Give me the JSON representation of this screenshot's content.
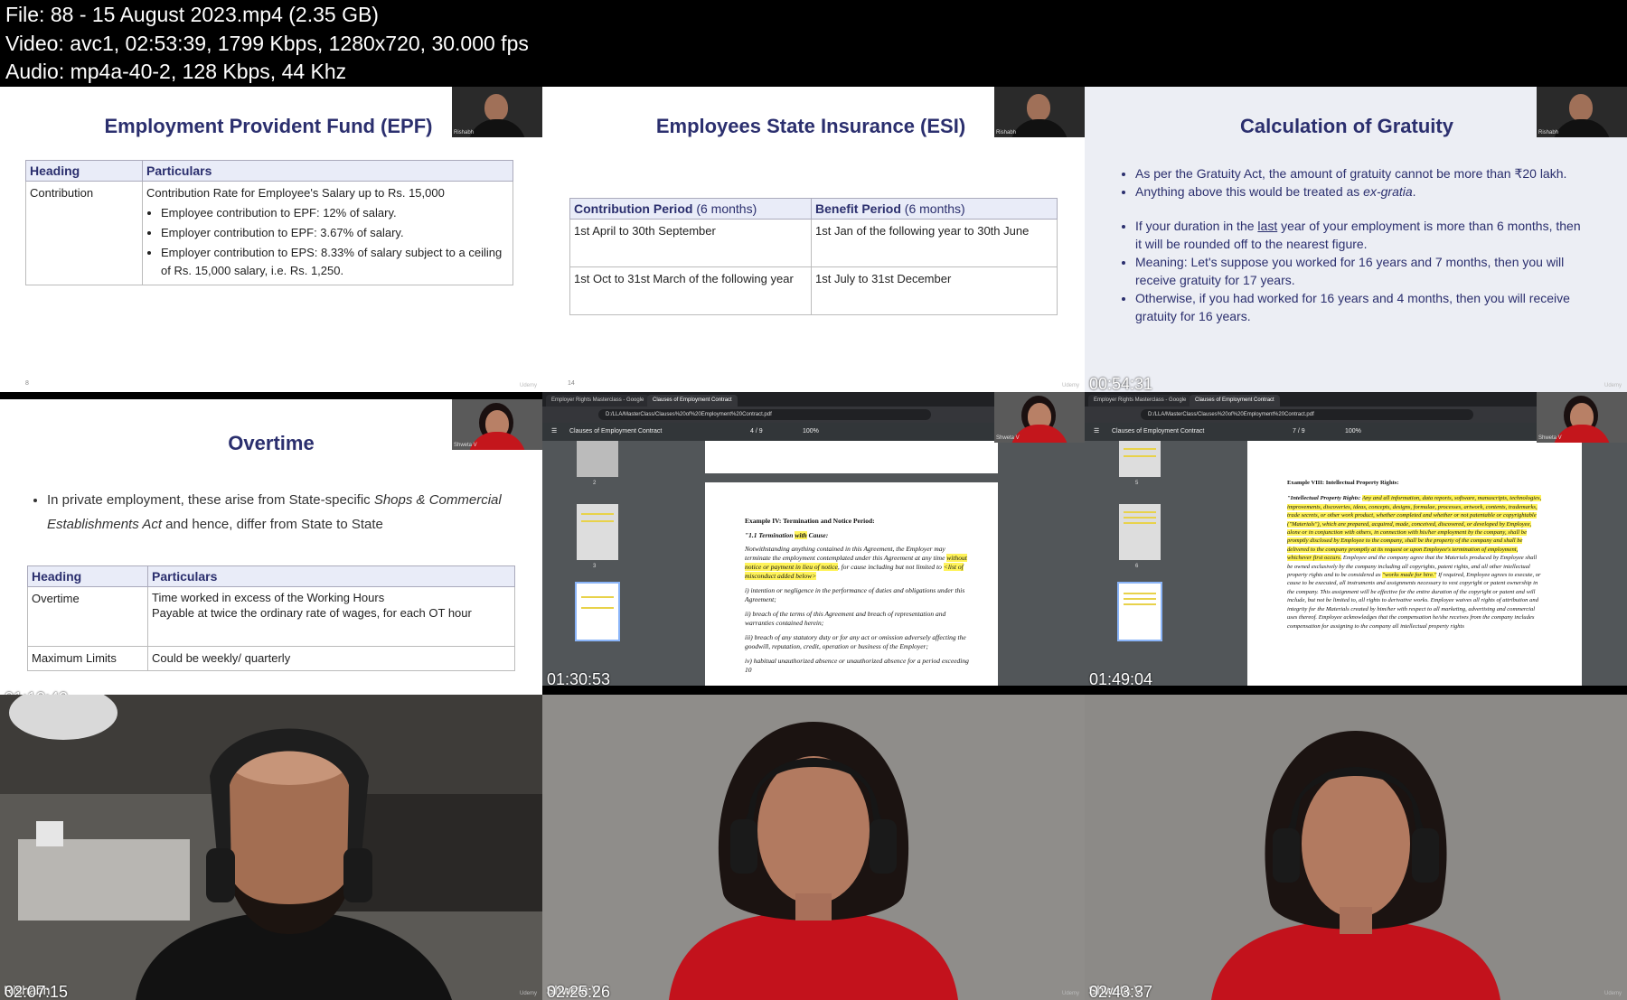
{
  "header": {
    "line1": "File: 88 - 15 August 2023.mp4 (2.35 GB)",
    "line2": "Video: avc1, 02:53:39, 1799 Kbps, 1280x720, 30.000 fps",
    "line3": "Audio: mp4a-40-2, 128 Kbps, 44 Khz"
  },
  "thumbs": [
    {
      "title": "Employment Provident Fund (EPF)",
      "col_heading": "Heading",
      "col_particulars": "Particulars",
      "row_heading": "Contribution",
      "row_intro": "Contribution Rate for Employee's Salary up to Rs. 15,000",
      "bullets": [
        "Employee contribution to EPF: 12% of salary.",
        "Employer contribution to EPF: 3.67% of salary.",
        "Employer contribution to EPS: 8.33% of salary subject to a ceiling of Rs. 15,000 salary, i.e. Rs. 1,250."
      ],
      "page": "8",
      "watermark": "Udemy",
      "cam_label": "Rishabh"
    },
    {
      "title": "Employees State Insurance (ESI)",
      "col1_bold": "Contribution Period",
      "col1_rest": " (6 months)",
      "col2_bold": "Benefit Period",
      "col2_rest": " (6 months)",
      "rows": [
        [
          "1st April to 30th September",
          "1st Jan of the following year to 30th June"
        ],
        [
          "1st Oct to 31st March of the following year",
          "1st July to 31st December"
        ]
      ],
      "page": "14",
      "watermark": "Udemy",
      "cam_label": "Rishabh"
    },
    {
      "title": "Calculation of Gratuity",
      "b1": "As per the Gratuity Act, the amount of gratuity cannot be more than ₹20 lakh.",
      "b2_pre": "Anything above this would be treated as ",
      "b2_em": "ex-gratia",
      "b2_post": ".",
      "b3_pre": "If your duration in the ",
      "b3_u": "last",
      "b3_post": " year of your employment is more than 6 months, then it will be rounded off to the nearest figure.",
      "b4": "Meaning: Let's suppose you worked for 16 years and 7 months, then you will receive gratuity for 17 years.",
      "b5": "Otherwise, if you had worked for 16 years and 4 months, then you will receive gratuity for 16 years.",
      "time": "00:54:31",
      "watermark": "Udemy",
      "cam_label": "Rishabh"
    },
    {
      "title": "Overtime",
      "intro_pre": "In private employment, these arise from State-specific ",
      "intro_em": "Shops & Commercial Establishments Act",
      "intro_post": " and hence, differ from State to State",
      "col_heading": "Heading",
      "col_particulars": "Particulars",
      "r1_head": "Overtime",
      "r1_line1": "Time worked in excess of the Working Hours",
      "r1_line2": "Payable at twice the ordinary rate of wages, for each OT hour",
      "r2_head": "Maximum Limits",
      "r2_val": "Could be weekly/ quarterly",
      "time": "01:12:42",
      "cam_label": "Shweta V"
    },
    {
      "tab1": "Employer Rights Masterclass - Google",
      "tab2": "Clauses of Employment Contract",
      "url": "D:/LLA/MasterClass/Clauses%20of%20Employment%20Contract.pdf",
      "doc_title": "Clauses of Employment Contract",
      "page_indicator": "4 / 9",
      "zoom": "100%",
      "thumb_labels": [
        "2",
        "3"
      ],
      "heading": "Example IV: Termination and Notice Period:",
      "sub_pre": "\"1.1 Termination ",
      "sub_hl": "with",
      "sub_post": " Cause:",
      "para1_pre": "Notwithstanding anything contained in this Agreement, the Employer may terminate the employment contemplated under this Agreement at any time ",
      "para1_hl1": "without notice or payment in lieu of notice",
      "para1_mid": ", for cause including but not limited to ",
      "para1_hl2": "<list of misconduct added below>",
      "item1": "i) intention or negligence in the performance of duties and obligations under this Agreement;",
      "item2": "ii) breach of the terms of this Agreement and breach of representation and warranties contained herein;",
      "item3": "iii) breach of any statutory duty or for any act or omission adversely affecting the goodwill, reputation, credit, operation or business of the Employer;",
      "item4": "iv) habitual unauthorized absence or unauthorized absence for a period exceeding 10",
      "time": "01:30:53",
      "cam_label": "Shweta V"
    },
    {
      "tab1": "Employer Rights Masterclass - Google",
      "tab2": "Clauses of Employment Contract",
      "url": "D:/LLA/MasterClass/Clauses%20of%20Employment%20Contract.pdf",
      "doc_title": "Clauses of Employment Contract",
      "page_indicator": "7 / 9",
      "zoom": "100%",
      "thumb_labels": [
        "5",
        "6"
      ],
      "heading": "Example VIII: Intellectual Property Rights:",
      "para_pre": "\"Intellectual Property Rights: ",
      "para_hl": "Any and all information, data reports, software, manuscripts, technologies, improvements, discoveries, ideas, concepts, designs, formulae, processes, artwork, contents, trademarks, trade secrets, or other work product, whether completed and whether or not patentable or copyrightable (\"Materials\"), which are prepared, acquired, made, conceived, discovered, or developed by Employee, alone or in conjunction with others, in connection with his/her employment by the company, shall be promptly disclosed by Employee to the company, shall be the property of the company and shall be delivered to the company promptly at its request or upon Employee's termination of employment, whichever first occurs.",
      "para_mid": " Employee and the company agree that the Materials produced by Employee shall be owned exclusively by the company including all copyrights, patent rights, and all other intellectual property rights and to be considered as ",
      "para_hl2": "\"works made for hire.\"",
      "para_post": " If required, Employee agrees to execute, or cause to be executed, all instruments and assignments necessary to vest copyright or patent ownership in the company. This assignment will be effective for the entire duration of the copyright or patent and will include, but not be limited to, all rights to derivative works. Employee waives all rights of attribution and integrity for the Materials created by him/her with respect to all marketing, advertising and commercial uses thereof. Employee acknowledges that the compensation he/she receives from the company includes compensation for assigning to the company all intellectual property rights",
      "time": "01:49:04",
      "cam_label": "Shweta V"
    },
    {
      "time": "02:07:15",
      "name": "Rishabh",
      "watermark": "Udemy"
    },
    {
      "time": "02:25:26",
      "name": "Shweta V",
      "watermark": "Udemy"
    },
    {
      "time": "02:43:37",
      "name": "Shweta V",
      "watermark": "Udemy"
    }
  ],
  "colors": {
    "title": "#2b2f6e",
    "highlight": "#fff35a",
    "tableHeader": "#e9ecf8"
  }
}
